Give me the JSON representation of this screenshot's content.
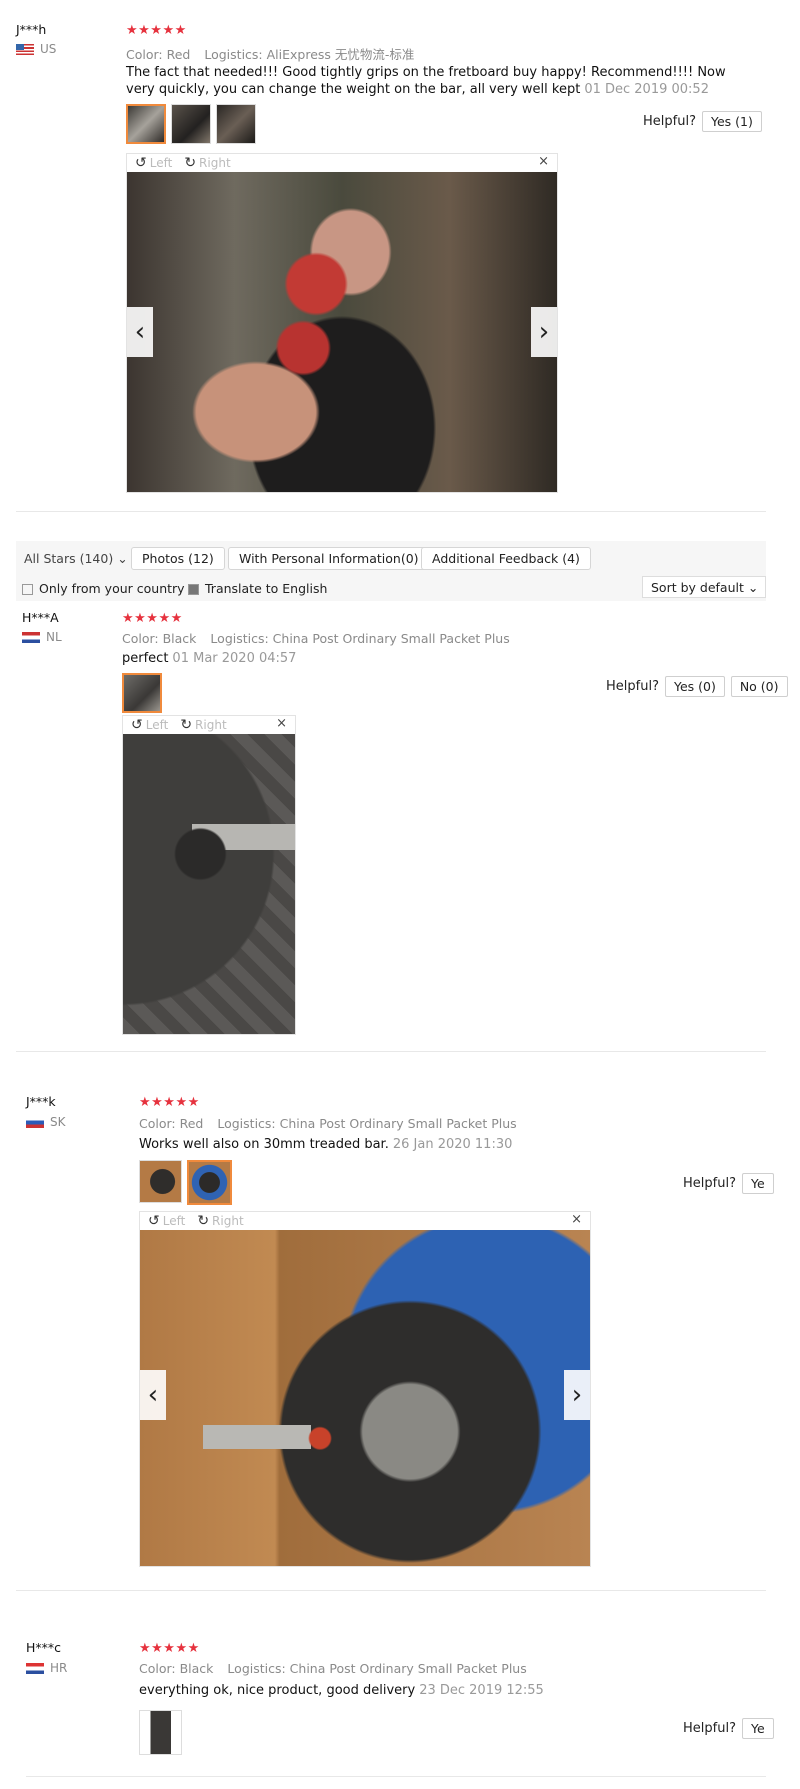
{
  "reviews": [
    {
      "user": "J***h",
      "country": "US",
      "stars": "★★★★★",
      "color": "Color: Red",
      "logistics": "Logistics: AliExpress 无忧物流-标准",
      "text": "The fact that needed!!! Good tightly grips on the fretboard buy happy! Recommend!!!! Now very quickly, you can change the weight on the bar, all very well kept",
      "date": "01 Dec 2019 00:52",
      "helpful_label": "Helpful?",
      "yes_label": "Yes (1)"
    },
    {
      "user": "H***A",
      "country": "NL",
      "stars": "★★★★★",
      "color": "Color: Black",
      "logistics": "Logistics: China Post Ordinary Small Packet Plus",
      "text": "perfect",
      "date": "01 Mar 2020 04:57",
      "helpful_label": "Helpful?",
      "yes_label": "Yes (0)",
      "no_label": "No (0)"
    },
    {
      "user": "J***k",
      "country": "SK",
      "stars": "★★★★★",
      "color": "Color: Red",
      "logistics": "Logistics: China Post Ordinary Small Packet Plus",
      "text": "Works well also on 30mm treaded bar.",
      "date": "26 Jan 2020 11:30",
      "helpful_label": "Helpful?",
      "yes_label": "Ye"
    },
    {
      "user": "H***c",
      "country": "HR",
      "stars": "★★★★★",
      "color": "Color: Black",
      "logistics": "Logistics: China Post Ordinary Small Packet Plus",
      "text": "everything ok, nice product, good delivery",
      "date": "23 Dec 2019 12:55",
      "helpful_label": "Helpful?",
      "yes_label": "Ye"
    }
  ],
  "viewer": {
    "left_label": "Left",
    "right_label": "Right",
    "close": "×",
    "prev": "‹",
    "next": "›"
  },
  "filters": {
    "all_stars": "All Stars (140)",
    "photos": "Photos (12)",
    "personal": "With Personal Information(0)",
    "additional": "Additional Feedback (4)",
    "only_country": "Only from your country",
    "translate": "Translate to English",
    "sort": "Sort by default"
  },
  "colors": {
    "star": "#e6323e",
    "accent": "#f08a3c",
    "meta": "#8a8a8a"
  }
}
